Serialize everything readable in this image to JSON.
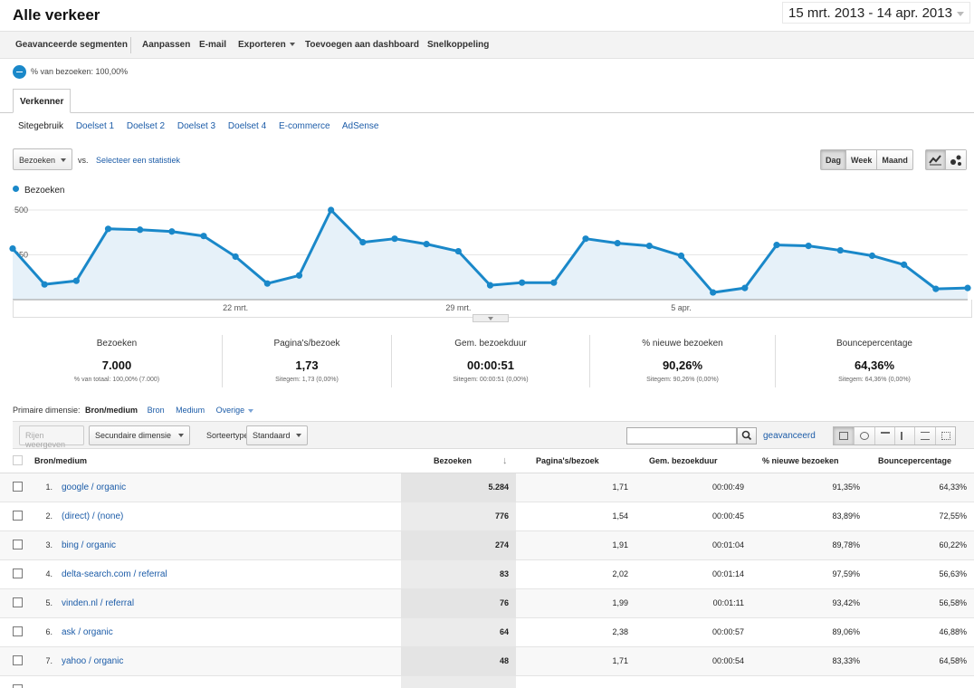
{
  "header": {
    "title": "Alle verkeer",
    "date_range": "15 mrt. 2013 - 14 apr. 2013"
  },
  "toolbar": {
    "advanced_segments": "Geavanceerde segmenten",
    "customize": "Aanpassen",
    "email": "E-mail",
    "export": "Exporteren",
    "add_to_dashboard": "Toevoegen aan dashboard",
    "shortcut": "Snelkoppeling"
  },
  "segment": {
    "label": "% van bezoeken: 100,00%"
  },
  "explorer": {
    "tab": "Verkenner",
    "subtabs": [
      "Sitegebruik",
      "Doelset 1",
      "Doelset 2",
      "Doelset 3",
      "Doelset 4",
      "E-commerce",
      "AdSense"
    ]
  },
  "chart_controls": {
    "metric": "Bezoeken",
    "vs": "vs.",
    "select_metric": "Selecteer een statistiek",
    "periods": [
      "Dag",
      "Week",
      "Maand"
    ],
    "active_period": "Dag",
    "line_chart_icon": "line-chart-icon",
    "motion_chart_icon": "motion-chart-icon"
  },
  "chart_data": {
    "type": "area",
    "series": [
      {
        "name": "Bezoeken",
        "color": "#1a88c9",
        "values": [
          285,
          85,
          105,
          395,
          390,
          380,
          355,
          240,
          90,
          135,
          500,
          320,
          340,
          310,
          270,
          80,
          95,
          95,
          340,
          315,
          300,
          245,
          40,
          65,
          305,
          300,
          275,
          245,
          195,
          60,
          65
        ]
      }
    ],
    "x_tick_labels": [
      "22 mrt.",
      "29 mrt.",
      "5 apr."
    ],
    "y_tick_labels": [
      "500",
      "250"
    ],
    "ylim": [
      0,
      500
    ],
    "grid": true,
    "legend": "top-left"
  },
  "scorecards": [
    {
      "label": "Bezoeken",
      "value": "7.000",
      "sub": "% van totaal: 100,00% (7.000)"
    },
    {
      "label": "Pagina's/bezoek",
      "value": "1,73",
      "sub": "Sitegem: 1,73 (0,00%)"
    },
    {
      "label": "Gem. bezoekduur",
      "value": "00:00:51",
      "sub": "Sitegem: 00:00:51 (0,00%)"
    },
    {
      "label": "% nieuwe bezoeken",
      "value": "90,26%",
      "sub": "Sitegem: 90,26% (0,00%)"
    },
    {
      "label": "Bouncepercentage",
      "value": "64,36%",
      "sub": "Sitegem: 64,36% (0,00%)"
    }
  ],
  "dimensions": {
    "label": "Primaire dimensie:",
    "current": "Bron/medium",
    "options": [
      "Bron",
      "Medium",
      "Overige"
    ]
  },
  "filterbar": {
    "plot_rows": "Rijen weergeven",
    "secondary_dimension": "Secundaire dimensie",
    "sort_type_label": "Sorteertype:",
    "sort_type": "Standaard",
    "search_value": "",
    "advanced": "geavanceerd"
  },
  "table": {
    "columns": [
      "Bron/medium",
      "Bezoeken",
      "Pagina's/bezoek",
      "Gem. bezoekduur",
      "% nieuwe bezoeken",
      "Bouncepercentage"
    ],
    "rows": [
      {
        "num": "1.",
        "source": "google / organic",
        "visits": "5.284",
        "pages": "1,71",
        "duration": "00:00:49",
        "new": "91,35%",
        "bounce": "64,33%"
      },
      {
        "num": "2.",
        "source": "(direct) / (none)",
        "visits": "776",
        "pages": "1,54",
        "duration": "00:00:45",
        "new": "83,89%",
        "bounce": "72,55%"
      },
      {
        "num": "3.",
        "source": "bing / organic",
        "visits": "274",
        "pages": "1,91",
        "duration": "00:01:04",
        "new": "89,78%",
        "bounce": "60,22%"
      },
      {
        "num": "4.",
        "source": "delta-search.com / referral",
        "visits": "83",
        "pages": "2,02",
        "duration": "00:01:14",
        "new": "97,59%",
        "bounce": "56,63%"
      },
      {
        "num": "5.",
        "source": "vinden.nl / referral",
        "visits": "76",
        "pages": "1,99",
        "duration": "00:01:11",
        "new": "93,42%",
        "bounce": "56,58%"
      },
      {
        "num": "6.",
        "source": "ask / organic",
        "visits": "64",
        "pages": "2,38",
        "duration": "00:00:57",
        "new": "89,06%",
        "bounce": "46,88%"
      },
      {
        "num": "7.",
        "source": "yahoo / organic",
        "visits": "48",
        "pages": "1,71",
        "duration": "00:00:54",
        "new": "83,33%",
        "bounce": "64,58%"
      }
    ]
  }
}
